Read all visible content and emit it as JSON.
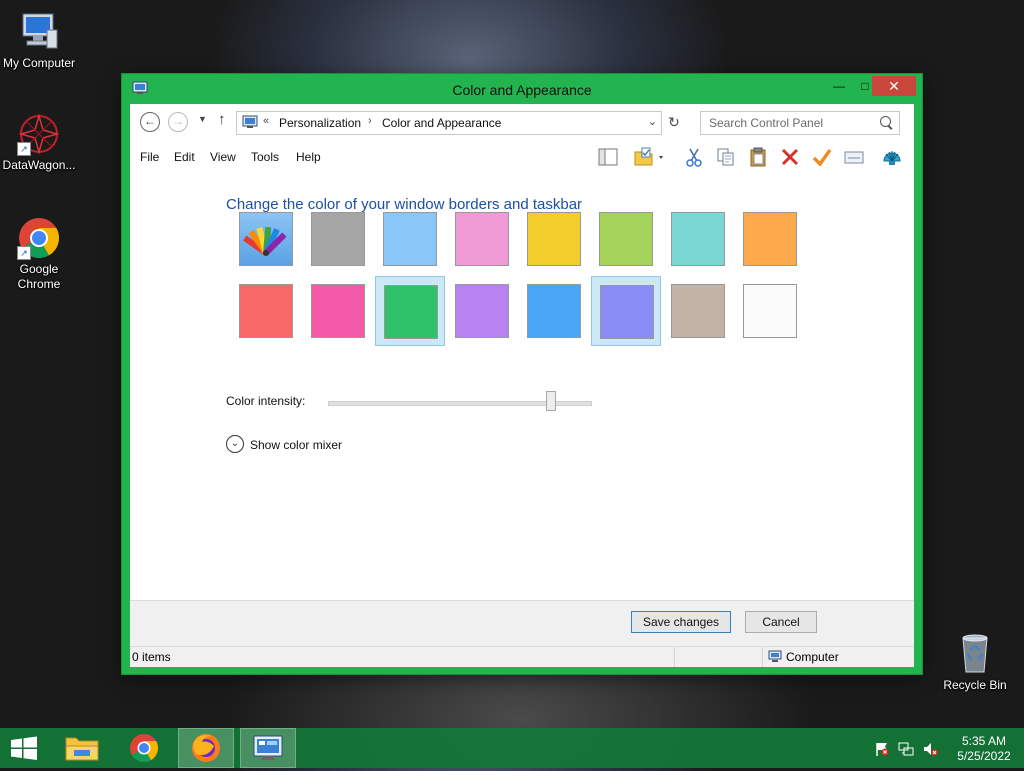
{
  "desktop": {
    "icons": [
      {
        "label": "My Computer"
      },
      {
        "label": "DataWagon..."
      },
      {
        "label": "Google Chrome"
      },
      {
        "label": "Recycle Bin"
      }
    ]
  },
  "window": {
    "title": "Color and Appearance",
    "accent_color": "#22b44e",
    "nav": {
      "recent_chevron": "«",
      "breadcrumb": [
        "Personalization",
        "Color and Appearance"
      ],
      "separator": "›",
      "search_placeholder": "Search Control Panel"
    },
    "menu": [
      "File",
      "Edit",
      "View",
      "Tools",
      "Help"
    ],
    "toolbar_icons": [
      "layout-pane-icon",
      "folder-options-icon",
      "cut-icon",
      "copy-icon",
      "paste-icon",
      "delete-icon",
      "check-icon",
      "properties-icon",
      "shell-icon"
    ]
  },
  "content": {
    "heading": "Change the color of your window borders and taskbar",
    "swatches": [
      {
        "color": "automatic",
        "icon": "color-palette-icon",
        "selected": false
      },
      {
        "color": "#a6a6a6",
        "selected": false
      },
      {
        "color": "#8ac7f7",
        "selected": false
      },
      {
        "color": "#f09ad6",
        "selected": false
      },
      {
        "color": "#f2ce2c",
        "selected": false
      },
      {
        "color": "#a6d45a",
        "selected": false
      },
      {
        "color": "#7ad8d4",
        "selected": false
      },
      {
        "color": "#fdaa4d",
        "selected": false
      },
      {
        "color": "#f96969",
        "selected": false
      },
      {
        "color": "#f45aa8",
        "selected": false
      },
      {
        "color": "#2fc26a",
        "selected": true
      },
      {
        "color": "#b982f1",
        "selected": false
      },
      {
        "color": "#4ba5f6",
        "selected": false
      },
      {
        "color": "#8a8df5",
        "selected": true
      },
      {
        "color": "#c3b3a6",
        "selected": false
      },
      {
        "color": "#fbfbfb",
        "selected": false
      }
    ],
    "intensity_label": "Color intensity:",
    "intensity_value": 0.85,
    "mixer_label": "Show color mixer"
  },
  "footer": {
    "save_label": "Save changes",
    "cancel_label": "Cancel"
  },
  "statusbar": {
    "items": "0 items",
    "location": "Computer"
  },
  "taskbar": {
    "pinned": [
      "windows-start-icon",
      "file-explorer-icon",
      "chrome-icon",
      "firefox-icon",
      "control-panel-icon"
    ],
    "time": "5:35 AM",
    "date": "5/25/2022"
  }
}
